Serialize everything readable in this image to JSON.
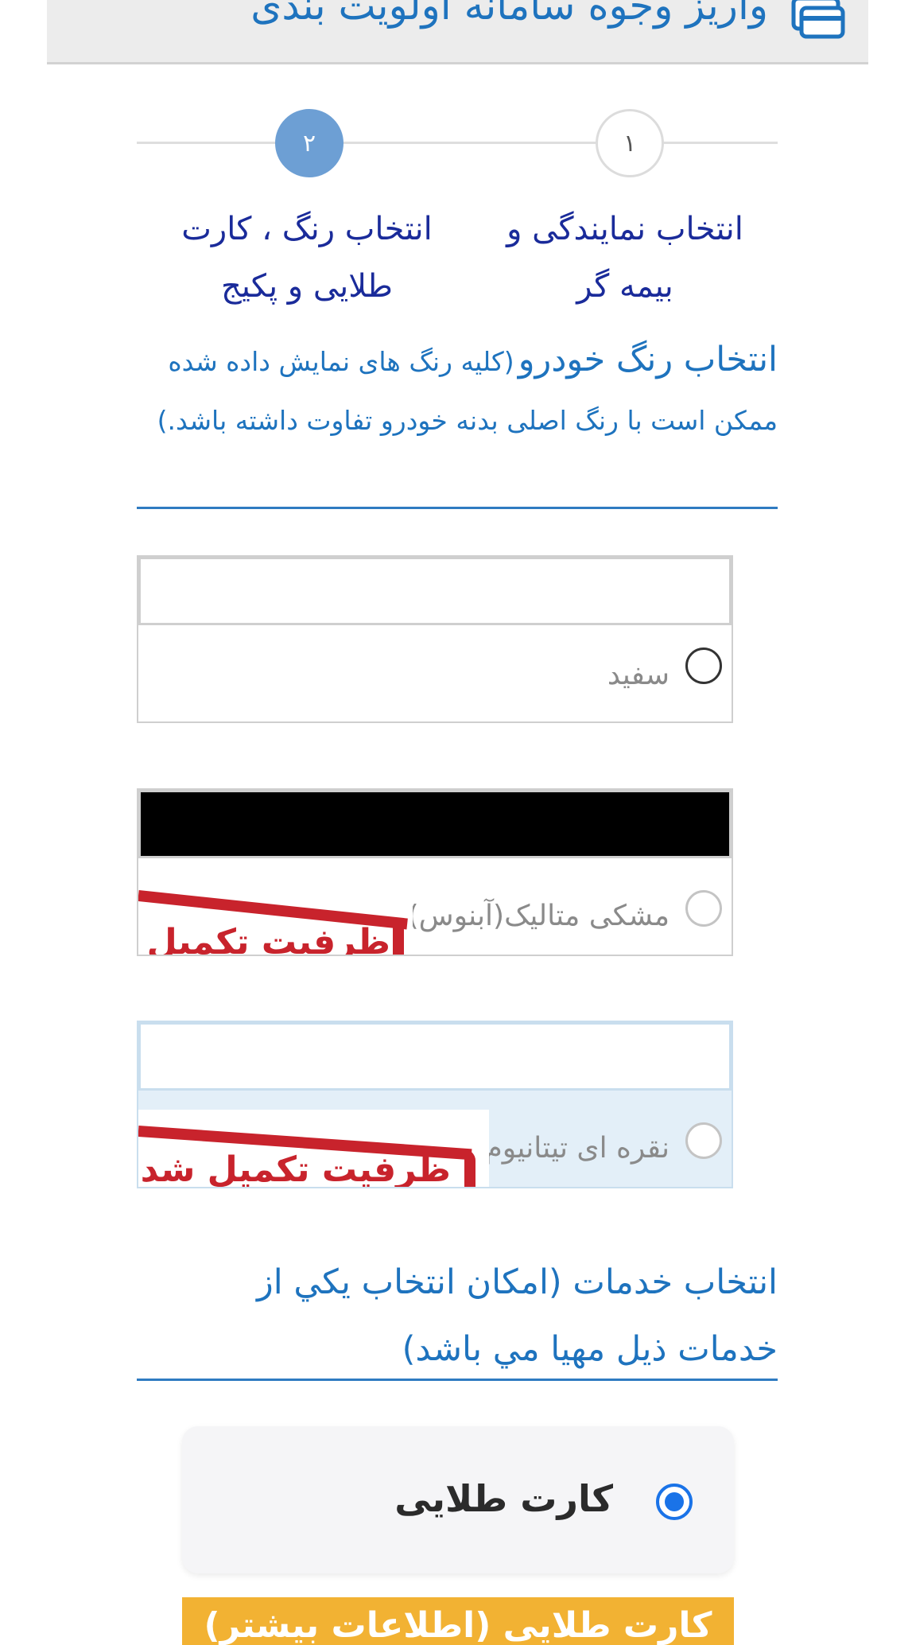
{
  "header": {
    "title": "واریز وجوه سامانه اولویت بندی",
    "icon": "credit-card-icon"
  },
  "stepper": {
    "steps": [
      {
        "number": "۱",
        "label_line1": "انتخاب نمایندگی و",
        "label_line2": "بیمه گر"
      },
      {
        "number": "۲",
        "label_line1": "انتخاب رنگ ، کارت",
        "label_line2": "طلایی و پکیج"
      }
    ],
    "active_step": 2
  },
  "color_section": {
    "title": "انتخاب رنگ خودرو",
    "note": "(کلیه رنگ های نمایش داده شده ممکن است با رنگ اصلی بدنه خودرو تفاوت داشته باشد.)"
  },
  "colors": [
    {
      "label": "سفید",
      "swatch": "#ffffff",
      "enabled": true
    },
    {
      "label": "مشکی متالیک(آبنوس)",
      "swatch": "#000000",
      "enabled": false,
      "stamp": "ظرفیت تکمیل شد"
    },
    {
      "label": "نقره ای تیتانیوم",
      "swatch": "#ffffff",
      "enabled": false,
      "stamp": "ظرفیت تکمیل شد"
    }
  ],
  "services_section": {
    "title_line1": "انتخاب خدمات (امکان انتخاب یکي از",
    "title_line2": "خدمات ذیل مهیا مي باشد)"
  },
  "service_card": {
    "label": "کارت طلایی",
    "selected": true
  },
  "more_button": {
    "label": "کارت طلایی (اطلاعات بیشتر)"
  },
  "theme": {
    "primary": "#1e73be",
    "step_active": "#6d9fd4",
    "stamp_red": "#c8232c",
    "button_yellow": "#f2b233"
  }
}
